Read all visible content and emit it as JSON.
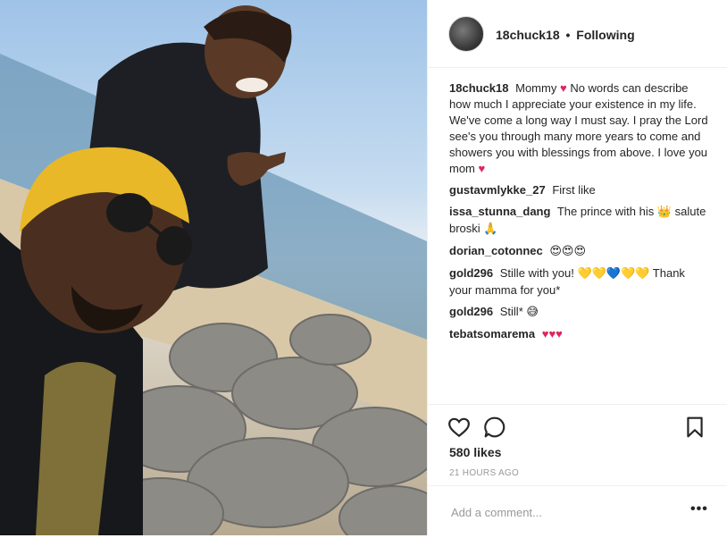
{
  "post": {
    "photo_description": "selfie photo on rocky beach",
    "author": "18chuck18",
    "follow_status": "Following",
    "separator": "•"
  },
  "caption": {
    "username": "18chuck18",
    "text_1": "Mommy",
    "text_2": "No words can describe how much I appreciate your existence in my life. We've come a long way I must say. I pray the Lord see's you through many more years to come and showers you with blessings from above. I love you mom",
    "heart": "♥"
  },
  "comments": [
    {
      "username": "gustavmlykke_27",
      "text": "First like"
    },
    {
      "username": "issa_stunna_dang",
      "text": "The prince with his",
      "emoji_1": "👑",
      "text_2": "salute broski",
      "emoji_2": "🙏"
    },
    {
      "username": "dorian_cotonnec",
      "text": "😍😍😍"
    },
    {
      "username": "gold296",
      "text": "Stille with you!",
      "hearts": "💛💛💙💛💛",
      "text_2": "Thank your mamma for you*"
    },
    {
      "username": "gold296",
      "text": "Still*",
      "emoji": "😅"
    },
    {
      "username": "tebatsomarema",
      "text": "♥♥♥"
    }
  ],
  "actions": {
    "like_icon": "heart-outline-icon",
    "comment_icon": "comment-bubble-icon",
    "save_icon": "bookmark-icon"
  },
  "likes_text": "580 likes",
  "timestamp": "21 HOURS AGO",
  "add_comment": {
    "placeholder": "Add a comment...",
    "more": "•••"
  },
  "colors": {
    "heart": "#e0245e",
    "text": "#262626",
    "muted": "#999999",
    "border": "#efefef"
  }
}
